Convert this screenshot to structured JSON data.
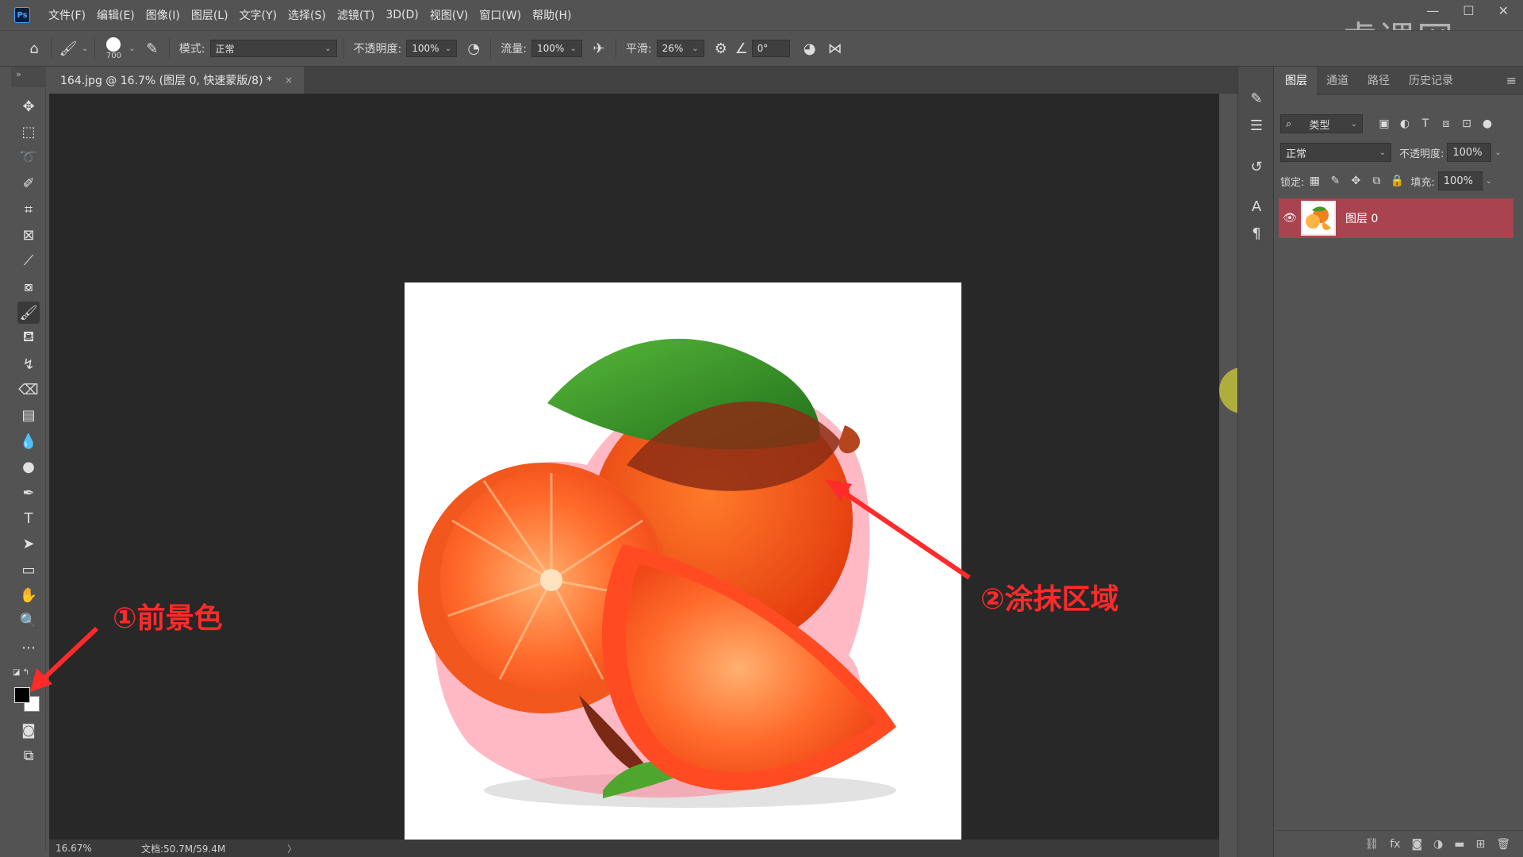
{
  "app": {
    "logo": "Ps"
  },
  "menu": [
    "文件(F)",
    "编辑(E)",
    "图像(I)",
    "图层(L)",
    "文字(Y)",
    "选择(S)",
    "滤镜(T)",
    "3D(D)",
    "视图(V)",
    "窗口(W)",
    "帮助(H)"
  ],
  "watermark": "虎课网",
  "options": {
    "brush_size": "700",
    "mode_label": "模式:",
    "mode_value": "正常",
    "opacity_label": "不透明度:",
    "opacity_value": "100%",
    "flow_label": "流量:",
    "flow_value": "100%",
    "smooth_label": "平滑:",
    "smooth_value": "26%",
    "angle_value": "0°"
  },
  "document": {
    "tab_title": "164.jpg @ 16.7% (图层 0, 快速蒙版/8) *",
    "close": "×"
  },
  "status": {
    "zoom": "16.67%",
    "doc_info": "文档:50.7M/59.4M",
    "arrow": "〉"
  },
  "annotations": {
    "foreground": "①前景色",
    "paint_area": "②涂抹区域",
    "colors": {
      "annotation": "#ff2a2a",
      "mask_overlay": "#ff6f8a"
    }
  },
  "panel": {
    "tabs": [
      "图层",
      "通道",
      "路径",
      "历史记录"
    ],
    "filter_label": "类型",
    "blend_mode": "正常",
    "opacity_label": "不透明度:",
    "opacity_value": "100%",
    "lock_label": "锁定:",
    "fill_label": "填充:",
    "fill_value": "100%",
    "layer_name": "图层 0",
    "colors": {
      "selected_layer": "#a9434f"
    }
  },
  "icons": [
    "home-icon",
    "brush-icon",
    "move-icon",
    "marquee-icon",
    "lasso-icon",
    "crop-icon",
    "eyedropper-icon",
    "eraser-icon",
    "text-icon",
    "hand-icon",
    "zoom-icon",
    "quick-mask-icon",
    "eye-icon"
  ]
}
